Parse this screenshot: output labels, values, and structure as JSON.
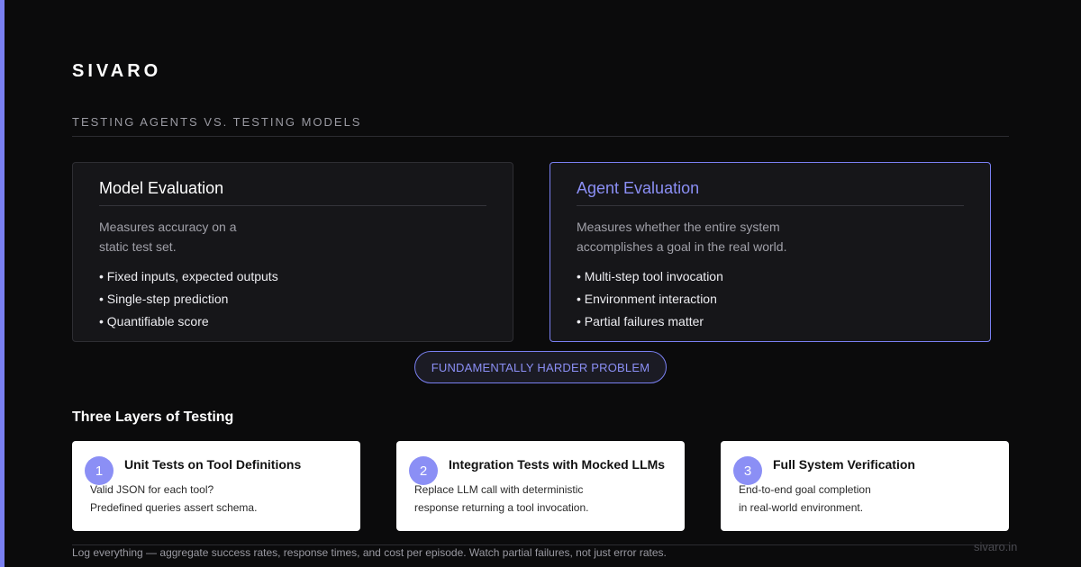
{
  "brand": "SIVARO",
  "subtitle": "TESTING AGENTS VS. TESTING MODELS",
  "model_card": {
    "title": "Model Evaluation",
    "description_lines": [
      "Measures accuracy on a",
      "static test set."
    ],
    "bullets": [
      "Fixed inputs, expected outputs",
      "Single-step prediction",
      "Quantifiable score"
    ]
  },
  "agent_card": {
    "title": "Agent Evaluation",
    "description_lines": [
      "Measures whether the entire system",
      "accomplishes a goal in the real world."
    ],
    "bullets": [
      "Multi-step tool invocation",
      "Environment interaction",
      "Partial failures matter"
    ]
  },
  "pill": "FUNDAMENTALLY HARDER PROBLEM",
  "layers_heading": "Three Layers of Testing",
  "layers": [
    {
      "number": "1",
      "title": "Unit Tests on Tool Definitions",
      "lines": [
        "Valid JSON for each tool?",
        "Predefined queries assert schema."
      ]
    },
    {
      "number": "2",
      "title": "Integration Tests with Mocked LLMs",
      "lines": [
        "Replace LLM call with deterministic",
        "response returning a tool invocation."
      ]
    },
    {
      "number": "3",
      "title": "Full System Verification",
      "lines": [
        "End-to-end goal completion",
        "in real-world environment."
      ]
    }
  ],
  "footer_note": "Log everything — aggregate success rates, response times, and cost per episode. Watch partial failures, not just error rates.",
  "site": "sivaro.in",
  "colors": {
    "accent": "#7a80f2",
    "accent_text": "#8b8ff5",
    "background": "#0b0b0c",
    "card": "#161619"
  }
}
